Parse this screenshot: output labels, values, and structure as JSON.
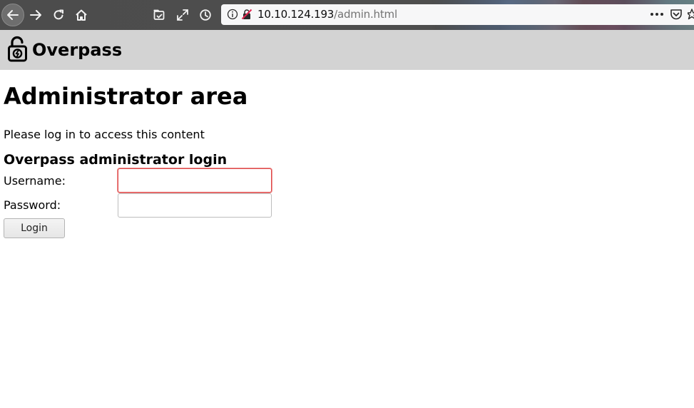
{
  "browser": {
    "url_host": "10.10.124.193",
    "url_path": "/admin.html",
    "icons": [
      "back-icon",
      "forward-icon",
      "reload-icon",
      "home-icon",
      "library-icon",
      "fullscreen-icon",
      "history-icon",
      "info-icon",
      "insecure-lock-icon",
      "more-icon",
      "pocket-icon",
      "bookmark-star-icon"
    ]
  },
  "site": {
    "name": "Overpass",
    "logo_icon": "padlock-icon"
  },
  "main": {
    "title": "Administrator area",
    "intro": "Please log in to access this content",
    "login": {
      "heading": "Overpass administrator login",
      "username_label": "Username:",
      "username_value": "",
      "password_label": "Password:",
      "password_value": "",
      "submit_label": "Login"
    }
  },
  "colors": {
    "header_bg": "#d3d3d3",
    "focus_border": "#e04848",
    "toolbar_bg": "#4e4e4e"
  }
}
